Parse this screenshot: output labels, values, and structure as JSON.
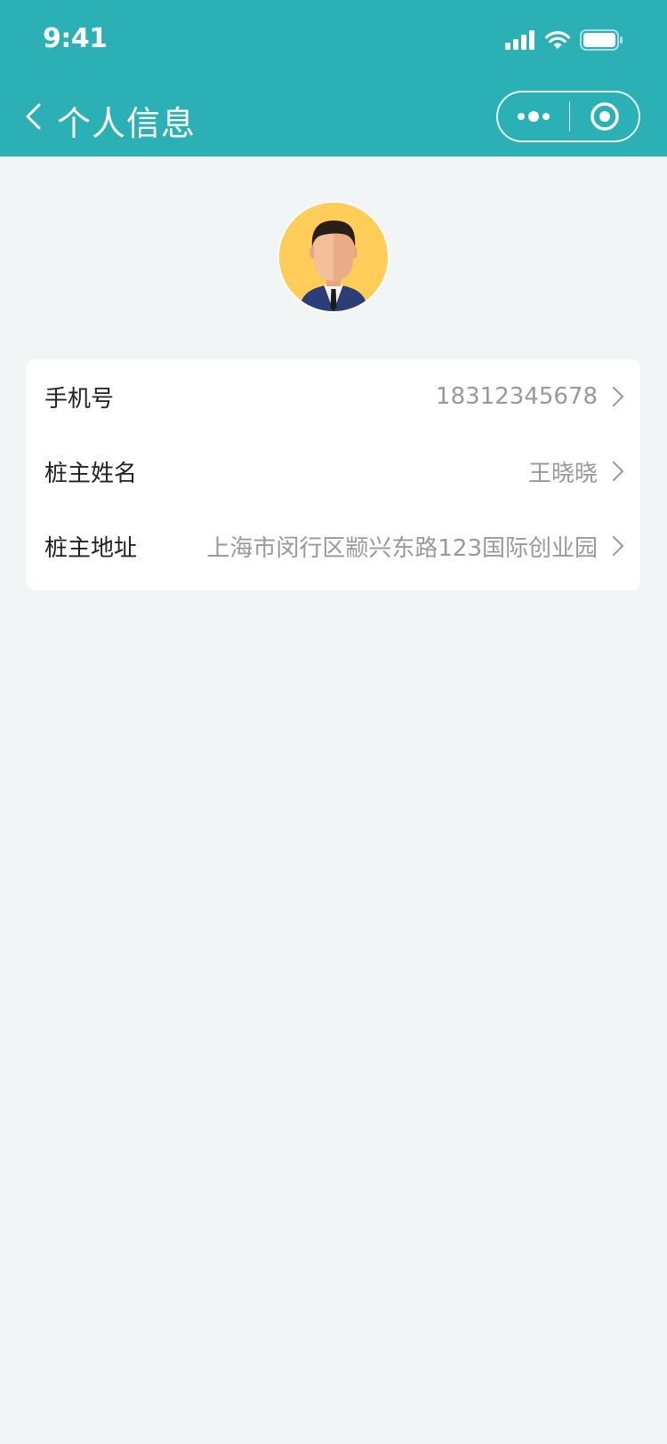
{
  "status_bar": {
    "time": "9:41"
  },
  "nav": {
    "title": "个人信息"
  },
  "avatar": {
    "icon": "user-avatar-icon"
  },
  "info": {
    "rows": [
      {
        "label": "手机号",
        "value": "18312345678"
      },
      {
        "label": "桩主姓名",
        "value": "王晓晓"
      },
      {
        "label": "桩主地址",
        "value": "上海市闵行区颛兴东路123国际创业园"
      }
    ]
  },
  "colors": {
    "header": "#2bb0b5",
    "background": "#f2f5f6",
    "avatar_bg": "#ffcd58"
  }
}
